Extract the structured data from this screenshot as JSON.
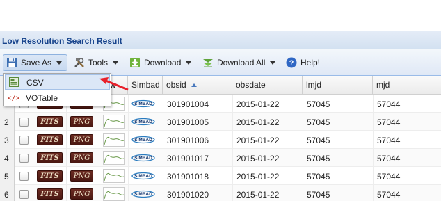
{
  "panel": {
    "title": "Low Resolution Search Result"
  },
  "toolbar": {
    "save_as": "Save As",
    "tools": "Tools",
    "download": "Download",
    "download_all": "Download All",
    "help": "Help!"
  },
  "save_menu": {
    "items": [
      "CSV",
      "VOTable"
    ]
  },
  "columns": {
    "w": "w",
    "simbad": "Simbad",
    "obsid": "obsid",
    "obsdate": "obsdate",
    "lmjd": "lmjd",
    "mjd": "mjd"
  },
  "badges": {
    "fits": "FITS",
    "png": "PNG"
  },
  "simbad_logo": "SIMBAD",
  "rows": [
    {
      "n": "",
      "obsid": "301901004",
      "obsdate": "2015-01-22",
      "lmjd": "57045",
      "mjd": "57044"
    },
    {
      "n": "2",
      "obsid": "301901005",
      "obsdate": "2015-01-22",
      "lmjd": "57045",
      "mjd": "57044"
    },
    {
      "n": "3",
      "obsid": "301901006",
      "obsdate": "2015-01-22",
      "lmjd": "57045",
      "mjd": "57044"
    },
    {
      "n": "4",
      "obsid": "301901017",
      "obsdate": "2015-01-22",
      "lmjd": "57045",
      "mjd": "57044"
    },
    {
      "n": "5",
      "obsid": "301901018",
      "obsdate": "2015-01-22",
      "lmjd": "57045",
      "mjd": "57044"
    },
    {
      "n": "6",
      "obsid": "301901020",
      "obsdate": "2015-01-22",
      "lmjd": "57045",
      "mjd": "57044"
    }
  ],
  "colors": {
    "annotation_arrow": "#e8202a",
    "header_text": "#15428b",
    "fits_badge": "#5a1f17"
  }
}
